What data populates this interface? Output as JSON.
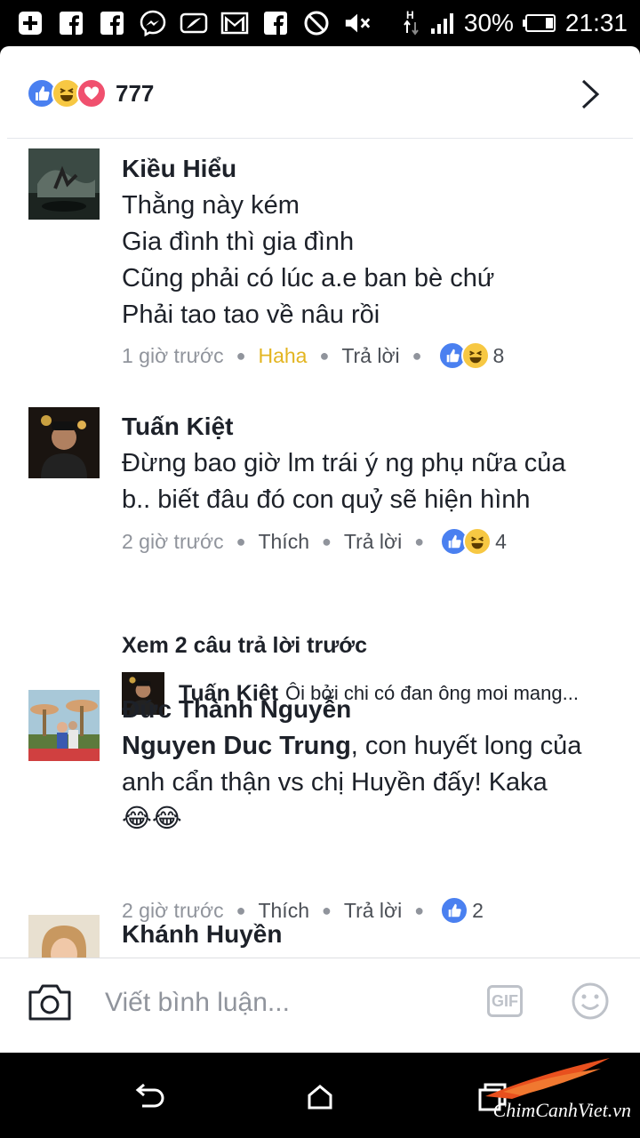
{
  "status_bar": {
    "icons": [
      "plus-box-icon",
      "facebook-icon",
      "facebook-icon",
      "messenger-icon",
      "feather-icon",
      "gmail-icon",
      "facebook-icon",
      "do-not-disturb-icon",
      "mute-icon",
      "data-arrows-icon",
      "signal-icon"
    ],
    "network": "H",
    "battery": "30%",
    "time": "21:31"
  },
  "reactions": {
    "types": [
      "like",
      "haha",
      "love"
    ],
    "count": "777",
    "colors": {
      "like": "#4a80f0",
      "haha": "#f7c843",
      "love": "#f0506e"
    }
  },
  "comments": [
    {
      "name": "Kiều Hiểu",
      "lines": [
        "Thằng này kém",
        "Gia đình thì gia đình",
        "Cũng phải có lúc a.e ban bè chứ",
        "Phải tao tao về nâu rồi"
      ],
      "time": "1 giờ trước",
      "reaction_action": "Haha",
      "reply": "Trả lời",
      "reactions": [
        "like",
        "haha"
      ],
      "reaction_count": "8"
    },
    {
      "name": "Tuấn Kiệt",
      "lines": [
        "Đừng bao giờ lm trái ý ng phụ nữa của",
        "b.. biết đâu đó con quỷ sẽ hiện hình"
      ],
      "time": "2 giờ trước",
      "reaction_action": "Thích",
      "reply": "Trả lời",
      "reactions": [
        "like",
        "haha"
      ],
      "reaction_count": "4",
      "view_previous": "Xem 2 câu trả lời trước",
      "reply_preview": {
        "name": "Tuấn Kiệt",
        "text": "Ôi bởi chi có đan ông moi mang..."
      }
    },
    {
      "name": "Đức Thành Nguyễn",
      "mention": "Nguyen Duc Trung",
      "line1_rest": ", con huyết long của",
      "line2": "anh cẩn thận vs chị Huyền đấy! Kaka",
      "emoji": "😂😂",
      "time": "2 giờ trước",
      "reaction_action": "Thích",
      "reply": "Trả lời",
      "reactions": [
        "like"
      ],
      "reaction_count": "2"
    },
    {
      "name": "Khánh Huyền"
    }
  ],
  "composer": {
    "placeholder": "Viết bình luận...",
    "gif_label": "GIF"
  },
  "nav": [
    "back-icon",
    "home-icon",
    "recents-icon"
  ],
  "watermark": "ChimCanhViet.vn"
}
